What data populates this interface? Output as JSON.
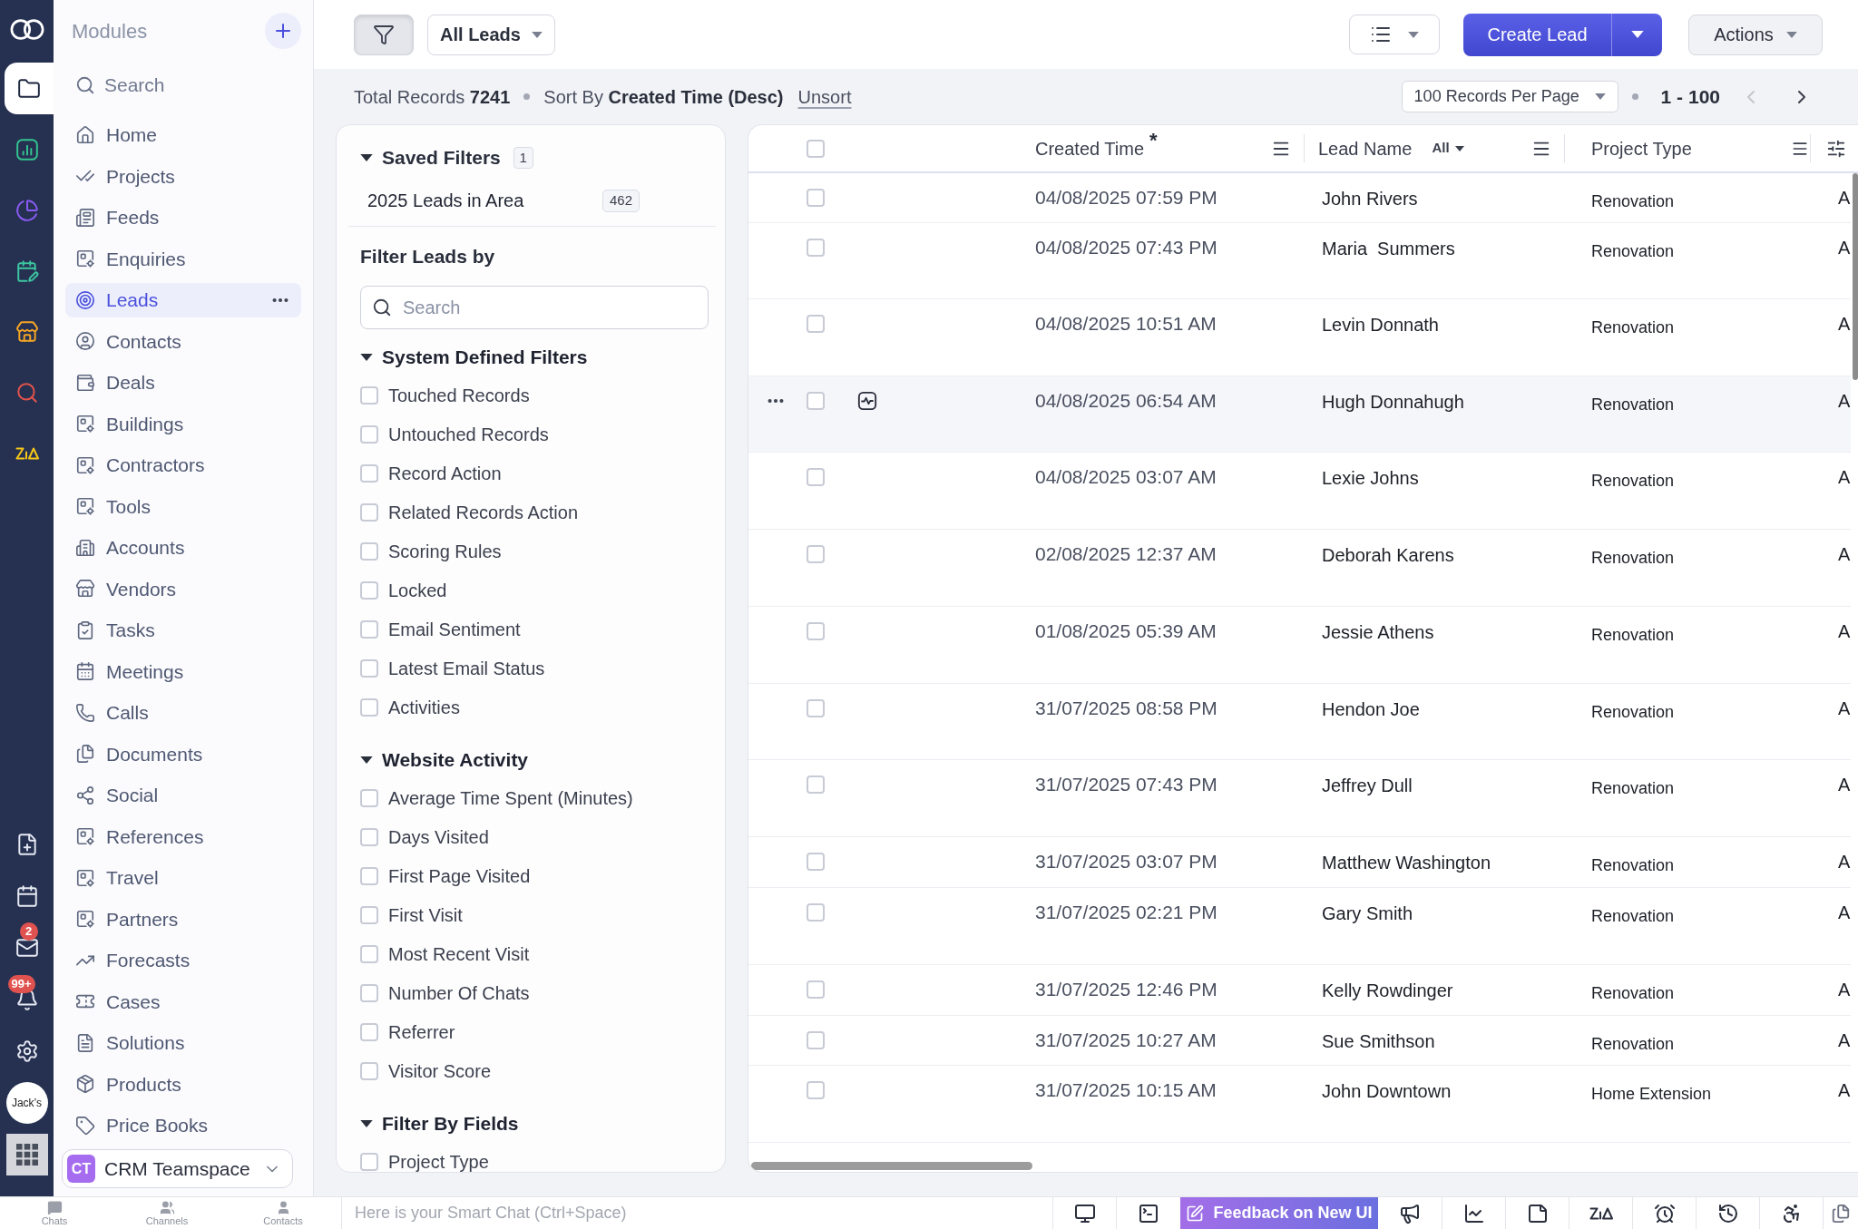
{
  "rail": {
    "apps": [
      {
        "selected": true
      },
      {
        "selected": false
      },
      {
        "selected": false
      },
      {
        "selected": false
      },
      {
        "selected": false
      },
      {
        "selected": false
      },
      {
        "selected": false
      }
    ],
    "badges": {
      "mail": "2",
      "alerts": "99+"
    },
    "avatar": {
      "label": "Jack’s"
    }
  },
  "sidebar": {
    "title": "Modules",
    "search": {
      "placeholder": "Search"
    },
    "items": [
      {
        "label": "Home",
        "selected": false
      },
      {
        "label": "Projects",
        "selected": false
      },
      {
        "label": "Feeds",
        "selected": false
      },
      {
        "label": "Enquiries",
        "selected": false
      },
      {
        "label": "Leads",
        "selected": true
      },
      {
        "label": "Contacts",
        "selected": false
      },
      {
        "label": "Deals",
        "selected": false
      },
      {
        "label": "Buildings",
        "selected": false
      },
      {
        "label": "Contractors",
        "selected": false
      },
      {
        "label": "Tools",
        "selected": false
      },
      {
        "label": "Accounts",
        "selected": false
      },
      {
        "label": "Vendors",
        "selected": false
      },
      {
        "label": "Tasks",
        "selected": false
      },
      {
        "label": "Meetings",
        "selected": false
      },
      {
        "label": "Calls",
        "selected": false
      },
      {
        "label": "Documents",
        "selected": false
      },
      {
        "label": "Social",
        "selected": false
      },
      {
        "label": "References",
        "selected": false
      },
      {
        "label": "Travel",
        "selected": false
      },
      {
        "label": "Partners",
        "selected": false
      },
      {
        "label": "Forecasts",
        "selected": false
      },
      {
        "label": "Cases",
        "selected": false
      },
      {
        "label": "Solutions",
        "selected": false
      },
      {
        "label": "Products",
        "selected": false
      },
      {
        "label": "Price Books",
        "selected": false
      }
    ],
    "workspace": {
      "initials": "CT",
      "name": "CRM Teamspace"
    }
  },
  "toolbar": {
    "filter_button": {
      "on": true
    },
    "view_select": {
      "value": "All Leads"
    },
    "create_button": {
      "label": "Create Lead"
    },
    "actions_button": {
      "label": "Actions"
    }
  },
  "summary": {
    "total": "Total Records **7241**",
    "sort": "Sort By **Created Time (Desc)**",
    "unsort_link": "Unsort",
    "per_page_select": {
      "value": "100 Records Per Page"
    },
    "range": "1 - 100",
    "prev_button": {
      "disabled": true
    },
    "next_button": {
      "disabled": false
    }
  },
  "filter_panel": {
    "saved_filters": {
      "title": "Saved Filters",
      "count": "1",
      "expanded": true,
      "items": [
        {
          "label": "2025 Leads in Area",
          "count": "462"
        }
      ]
    },
    "heading": "Filter Leads by",
    "search": {
      "placeholder": "Search"
    },
    "sections": [
      {
        "title": "System Defined Filters",
        "expanded": true,
        "items": [
          {
            "label": "Touched Records",
            "checked": false
          },
          {
            "label": "Untouched Records",
            "checked": false
          },
          {
            "label": "Record Action",
            "checked": false
          },
          {
            "label": "Related Records Action",
            "checked": false
          },
          {
            "label": "Scoring Rules",
            "checked": false
          },
          {
            "label": "Locked",
            "checked": false
          },
          {
            "label": "Email Sentiment",
            "checked": false
          },
          {
            "label": "Latest Email Status",
            "checked": false
          },
          {
            "label": "Activities",
            "checked": false
          }
        ]
      },
      {
        "title": "Website Activity",
        "expanded": true,
        "items": [
          {
            "label": "Average Time Spent (Minutes)",
            "checked": false
          },
          {
            "label": "Days Visited",
            "checked": false
          },
          {
            "label": "First Page Visited",
            "checked": false
          },
          {
            "label": "First Visit",
            "checked": false
          },
          {
            "label": "Most Recent Visit",
            "checked": false
          },
          {
            "label": "Number Of Chats",
            "checked": false
          },
          {
            "label": "Referrer",
            "checked": false
          },
          {
            "label": "Visitor Score",
            "checked": false
          }
        ]
      },
      {
        "title": "Filter By Fields",
        "expanded": true,
        "items": [
          {
            "label": "Project Type",
            "checked": false
          }
        ]
      }
    ]
  },
  "table": {
    "select_all": {
      "checked": false
    },
    "columns": [
      {
        "label": "Created Time",
        "sort_mark": "*"
      },
      {
        "label": "Lead Name",
        "filter": "All"
      },
      {
        "label": "Project Type"
      }
    ],
    "rows": [
      {
        "created_time": "04/08/2025 07:59 PM",
        "lead_name": "John Rivers",
        "project_type": "Renovation",
        "column_4": "A",
        "checked": false,
        "hovered": false
      },
      {
        "created_time": "04/08/2025 07:43 PM",
        "lead_name": "Maria  Summers",
        "project_type": "Renovation",
        "column_4": "A",
        "checked": false,
        "hovered": false
      },
      {
        "created_time": "04/08/2025 10:51 AM",
        "lead_name": "Levin Donnath",
        "project_type": "Renovation",
        "column_4": "A",
        "checked": false,
        "hovered": false
      },
      {
        "created_time": "04/08/2025 06:54 AM",
        "lead_name": "Hugh Donnahugh",
        "project_type": "Renovation",
        "column_4": "A",
        "checked": false,
        "hovered": true
      },
      {
        "created_time": "04/08/2025 03:07 AM",
        "lead_name": "Lexie Johns",
        "project_type": "Renovation",
        "column_4": "A",
        "checked": false,
        "hovered": false
      },
      {
        "created_time": "02/08/2025 12:37 AM",
        "lead_name": "Deborah Karens",
        "project_type": "Renovation",
        "column_4": "A",
        "checked": false,
        "hovered": false
      },
      {
        "created_time": "01/08/2025 05:39 AM",
        "lead_name": "Jessie Athens",
        "project_type": "Renovation",
        "column_4": "A",
        "checked": false,
        "hovered": false
      },
      {
        "created_time": "31/07/2025 08:58 PM",
        "lead_name": "Hendon Joe",
        "project_type": "Renovation",
        "column_4": "A",
        "checked": false,
        "hovered": false
      },
      {
        "created_time": "31/07/2025 07:43 PM",
        "lead_name": "Jeffrey Dull",
        "project_type": "Renovation",
        "column_4": "A",
        "checked": false,
        "hovered": false
      },
      {
        "created_time": "31/07/2025 03:07 PM",
        "lead_name": "Matthew Washington",
        "project_type": "Renovation",
        "column_4": "A",
        "checked": false,
        "hovered": false
      },
      {
        "created_time": "31/07/2025 02:21 PM",
        "lead_name": "Gary Smith",
        "project_type": "Renovation",
        "column_4": "A",
        "checked": false,
        "hovered": false
      },
      {
        "created_time": "31/07/2025 12:46 PM",
        "lead_name": "Kelly Rowdinger",
        "project_type": "Renovation",
        "column_4": "A",
        "checked": false,
        "hovered": false
      },
      {
        "created_time": "31/07/2025 10:27 AM",
        "lead_name": "Sue Smithson",
        "project_type": "Renovation",
        "column_4": "A",
        "checked": false,
        "hovered": false
      },
      {
        "created_time": "31/07/2025 10:15 AM",
        "lead_name": "John Downtown",
        "project_type": "Home Extension",
        "column_4": "A",
        "checked": false,
        "hovered": false
      }
    ]
  },
  "status_bar": {
    "tabs": [
      {
        "label": "Chats"
      },
      {
        "label": "Channels"
      },
      {
        "label": "Contacts"
      }
    ],
    "smart_chat": {
      "placeholder": "Here is your Smart Chat (Ctrl+Space)"
    },
    "feedback_button": {
      "label": "Feedback on New UI"
    }
  }
}
